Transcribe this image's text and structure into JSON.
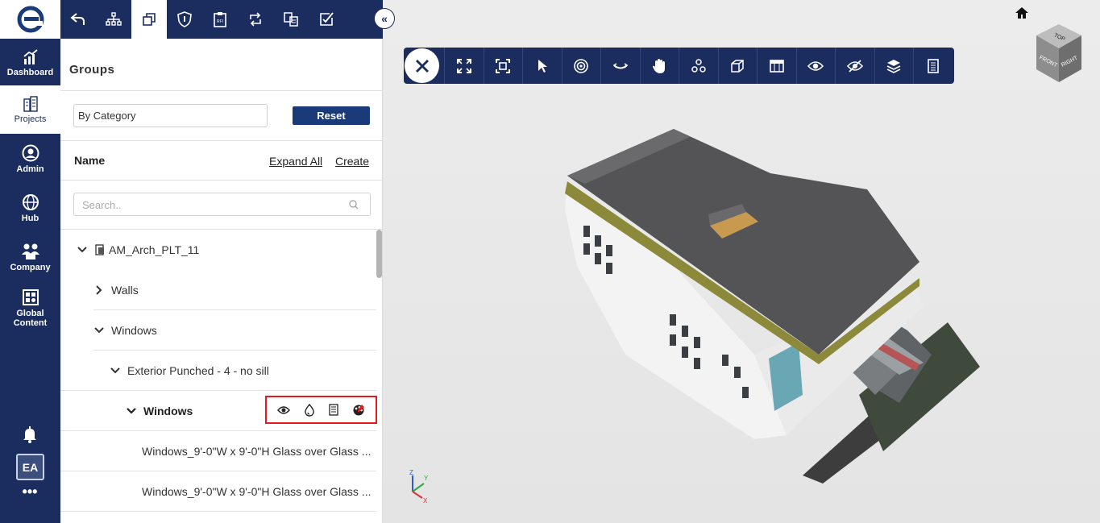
{
  "rail": {
    "items": [
      {
        "label": "Dashboard",
        "icon": "dashboard-chart-icon"
      },
      {
        "label": "Projects",
        "icon": "projects-buildings-icon"
      },
      {
        "label": "Admin",
        "icon": "admin-user-icon"
      },
      {
        "label": "Hub",
        "icon": "hub-globe-icon"
      },
      {
        "label": "Company",
        "icon": "company-people-icon"
      },
      {
        "label": "Global\nContent",
        "icon": "global-content-icon"
      }
    ],
    "avatar": "EA",
    "more": "•••"
  },
  "panel": {
    "title": "Groups",
    "category_value": "By Category",
    "reset_label": "Reset",
    "name_header": "Name",
    "expand_all": "Expand All",
    "create": "Create",
    "search_placeholder": "Search.."
  },
  "tree": [
    {
      "label": "AM_Arch_PLT_11"
    },
    {
      "label": "Walls"
    },
    {
      "label": "Windows"
    },
    {
      "label": "Exterior Punched - 4 - no sill"
    },
    {
      "label": "Windows"
    },
    {
      "label": "Windows_9'-0\"W x 9'-0\"H Glass over Glass ..."
    },
    {
      "label": "Windows_9'-0\"W x 9'-0\"H Glass over Glass ..."
    }
  ],
  "viewcube": {
    "top": "TOP",
    "front": "FRONT",
    "right": "RIGHT"
  },
  "axes": {
    "x": "X",
    "y": "Y",
    "z": "Z"
  },
  "colors": {
    "navy": "#1b2d5e",
    "highlight": "#e21b1b"
  }
}
